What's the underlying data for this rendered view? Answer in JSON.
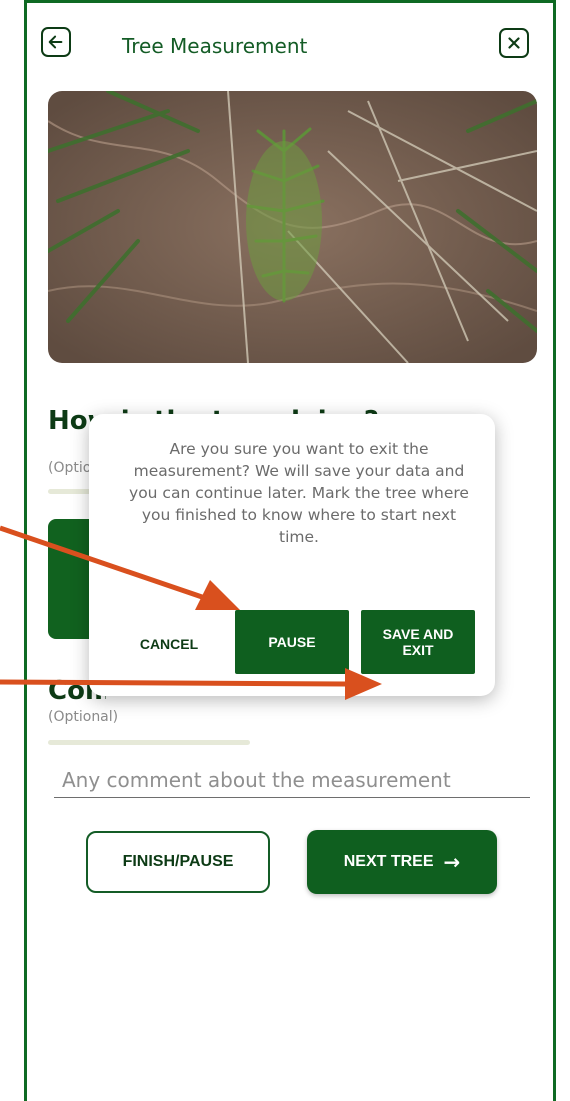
{
  "header": {
    "title": "Tree Measurement",
    "back_icon": "arrow-left-icon",
    "close_icon": "close-icon"
  },
  "measurement": {
    "question": "How is the tree doing?",
    "optional_label": "(Optional)"
  },
  "comments": {
    "title": "Comments",
    "optional_label": "(Optional)",
    "placeholder": "Any comment about the measurement"
  },
  "footer": {
    "finish_label": "FINISH/PAUSE",
    "next_label": "NEXT TREE",
    "next_icon": "→"
  },
  "dialog": {
    "message": "Are you sure you want to exit the measurement? We will save your data and you can continue later. Mark the tree where you finished to know where to start next time.",
    "cancel_label": "CANCEL",
    "pause_label": "PAUSE",
    "save_exit_label": "SAVE AND EXIT"
  },
  "colors": {
    "brand_green": "#0f5f1f",
    "frame_green": "#0f6a23",
    "annotation_orange": "#d9501e"
  }
}
